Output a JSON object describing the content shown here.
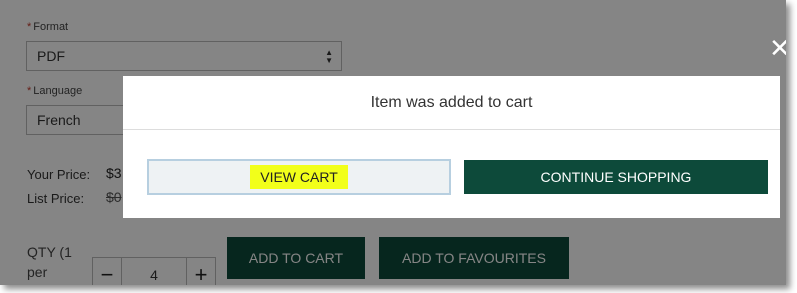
{
  "form": {
    "format": {
      "label": "Format",
      "required_mark": "*",
      "value": "PDF"
    },
    "language": {
      "label": "Language",
      "required_mark": "*",
      "value": "French"
    }
  },
  "pricing": {
    "your_price_label": "Your Price:",
    "your_price_value": "$3",
    "list_price_label": "List Price:",
    "list_price_value": "$0"
  },
  "quantity": {
    "label": "QTY (1 per",
    "value": "4",
    "minus": "−",
    "plus": "+"
  },
  "actions": {
    "add_to_cart": "ADD TO CART",
    "add_to_favourites": "ADD TO FAVOURITES"
  },
  "modal": {
    "message": "Item was added to cart",
    "view_cart_label": "VIEW CART",
    "continue_label": "CONTINUE SHOPPING",
    "close_glyph": "✕"
  },
  "colors": {
    "brand_green": "#0d4a3a",
    "highlight": "#f2ff1a"
  }
}
